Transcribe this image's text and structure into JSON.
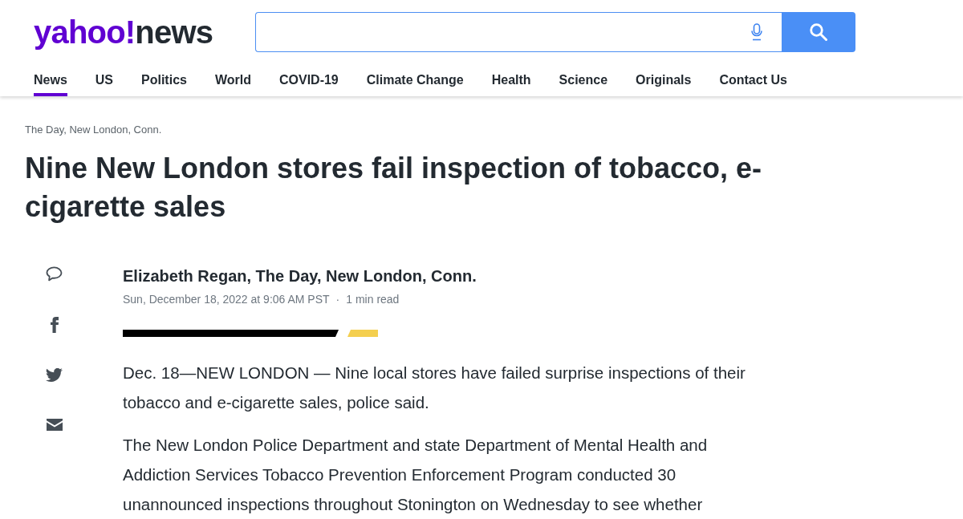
{
  "logo": {
    "brand": "yahoo!",
    "section": "news"
  },
  "nav": [
    {
      "label": "News",
      "selected": true
    },
    {
      "label": "US",
      "selected": false
    },
    {
      "label": "Politics",
      "selected": false
    },
    {
      "label": "World",
      "selected": false
    },
    {
      "label": "COVID-19",
      "selected": false
    },
    {
      "label": "Climate Change",
      "selected": false
    },
    {
      "label": "Health",
      "selected": false
    },
    {
      "label": "Science",
      "selected": false
    },
    {
      "label": "Originals",
      "selected": false
    },
    {
      "label": "Contact Us",
      "selected": false
    }
  ],
  "article": {
    "source": "The Day, New London, Conn.",
    "title": "Nine New London stores fail inspection of tobacco, e-cigarette sales",
    "author": "Elizabeth Regan, The Day, New London, Conn.",
    "published": "Sun, December 18, 2022 at 9:06 AM PST",
    "separator": "·",
    "read_time": "1 min read",
    "paragraphs": [
      "Dec. 18—NEW LONDON — Nine local stores have failed surprise inspections of their tobacco and e-cigarette sales, police said.",
      "The New London Police Department and state Department of Mental Health and Addiction Services Tobacco Prevention Enforcement Program conducted 30 unannounced inspections throughout Stonington on Wednesday to see whether"
    ]
  }
}
